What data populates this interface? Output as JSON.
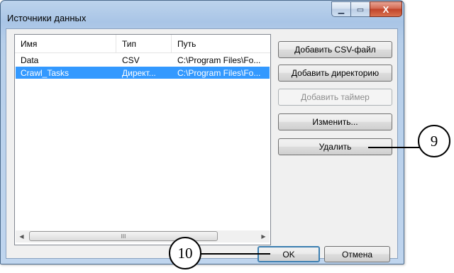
{
  "window": {
    "title": "Источники данных",
    "minimize_glyph": "▁",
    "maximize_glyph": "▭",
    "close_glyph": "X"
  },
  "list": {
    "columns": [
      "Имя",
      "Тип",
      "Путь"
    ],
    "rows": [
      {
        "name": "Data",
        "type": "CSV",
        "path": "C:\\Program Files\\Fo...",
        "selected": false
      },
      {
        "name": "Crawl_Tasks",
        "type": "Директ...",
        "path": "C:\\Program Files\\Fo...",
        "selected": true
      }
    ],
    "scroll_left_glyph": "◀",
    "scroll_right_glyph": "▶",
    "thumb_grip": "III"
  },
  "buttons": {
    "add_csv": "Добавить CSV-файл",
    "add_dir": "Добавить директорию",
    "add_timer": "Добавить таймер",
    "edit": "Изменить...",
    "delete": "Удалить",
    "ok": "OK",
    "cancel": "Отмена"
  },
  "callouts": {
    "delete_marker": "9",
    "ok_marker": "10"
  }
}
